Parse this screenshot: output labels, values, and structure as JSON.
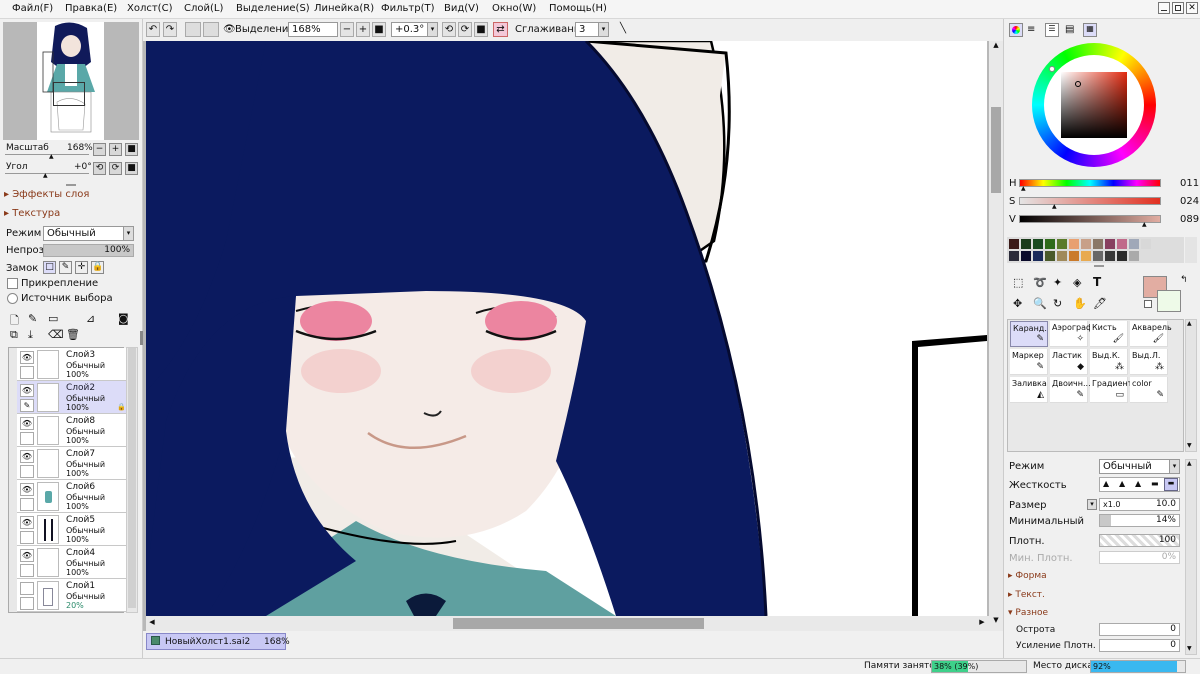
{
  "menu": [
    "Файл(F)",
    "Правка(E)",
    "Холст(C)",
    "Слой(L)",
    "Выделение(S)",
    "Линейка(R)",
    "Фильтр(T)",
    "Вид(V)",
    "Окно(W)",
    "Помощь(H)"
  ],
  "toolbar": {
    "selection_label": "Выделение",
    "zoom": "168%",
    "angle": "+0.3°",
    "smoothing_label": "Сглаживание",
    "smoothing_value": "3"
  },
  "navigator": {
    "scale_label": "Масштаб",
    "scale_value": "168%",
    "angle_label": "Угол",
    "angle_value": "+0°"
  },
  "left_panel": {
    "layer_effects": "Эффекты слоя",
    "texture": "Текстура",
    "mode_label": "Режим",
    "mode_value": "Обычный",
    "opacity_label": "Непроз.",
    "opacity_value": "100%",
    "opacity_level": 1.0,
    "lock_label": "Замок",
    "clipping_label": "Прикрепление",
    "selection_source_label": "Источник выбора"
  },
  "layers": [
    {
      "name": "Слой3",
      "mode": "Обычный",
      "opacity": "100%",
      "visible": true,
      "selected": false
    },
    {
      "name": "Слой2",
      "mode": "Обычный",
      "opacity": "100%",
      "visible": true,
      "selected": true
    },
    {
      "name": "Слой8",
      "mode": "Обычный",
      "opacity": "100%",
      "visible": true,
      "selected": false
    },
    {
      "name": "Слой7",
      "mode": "Обычный",
      "opacity": "100%",
      "visible": true,
      "selected": false
    },
    {
      "name": "Слой6",
      "mode": "Обычный",
      "opacity": "100%",
      "visible": true,
      "selected": false
    },
    {
      "name": "Слой5",
      "mode": "Обычный",
      "opacity": "100%",
      "visible": true,
      "selected": false
    },
    {
      "name": "Слой4",
      "mode": "Обычный",
      "opacity": "100%",
      "visible": true,
      "selected": false
    },
    {
      "name": "Слой1",
      "mode": "Обычный",
      "opacity": "20%",
      "visible": false,
      "selected": false
    }
  ],
  "color": {
    "h_label": "H",
    "h_value": "011",
    "s_label": "S",
    "s_value": "024",
    "v_label": "V",
    "v_value": "089",
    "current_color": "#e2ada2",
    "secondary_color": "#eefae8"
  },
  "palette": [
    "#3a1a18",
    "#1a3a1a",
    "#1a4a20",
    "#2e6a1a",
    "#5a7a2a",
    "#e8a070",
    "#c8a088",
    "#8a7868",
    "#884060",
    "#c06a8a",
    "#a0a8b8",
    "#d8d8d8",
    "#2a2a38",
    "#0a0a2a",
    "#1a2a5a",
    "#4a5a2a",
    "#a08a5a",
    "#ca7a2a",
    "#e8aa50",
    "#686868",
    "#383838",
    "#2a2a2a",
    "#aaa",
    "#ddd"
  ],
  "tools": [
    {
      "label": "Каранд.",
      "icon": "pencil-icon",
      "selected": true
    },
    {
      "label": "Аэрограф",
      "icon": "airbrush-icon",
      "selected": false
    },
    {
      "label": "Кисть",
      "icon": "brush-icon",
      "selected": false
    },
    {
      "label": "Акварель",
      "icon": "watercolor-icon",
      "selected": false
    },
    {
      "label": "Маркер",
      "icon": "marker-icon",
      "selected": false
    },
    {
      "label": "Ластик",
      "icon": "eraser-icon",
      "selected": false
    },
    {
      "label": "Выд.К.",
      "icon": "select-pen-icon",
      "selected": false
    },
    {
      "label": "Выд.Л.",
      "icon": "select-eraser-icon",
      "selected": false
    },
    {
      "label": "Заливка",
      "icon": "bucket-icon",
      "selected": false
    },
    {
      "label": "Двоичн...",
      "icon": "binary-pen-icon",
      "selected": false
    },
    {
      "label": "Градиент",
      "icon": "gradient-icon",
      "selected": false
    },
    {
      "label": "color",
      "icon": "color-pen-icon",
      "selected": false
    }
  ],
  "tool_settings": {
    "mode_label": "Режим",
    "mode_value": "Обычный",
    "hardness_label": "Жесткость",
    "size_label": "Размер",
    "size_mult": "x1.0",
    "size_value": "10.0",
    "min_label": "Минимальный",
    "min_value": "14%",
    "min_level": 0.14,
    "density_label": "Плотн.",
    "density_value": "100",
    "min_density_label": "Мин. Плотн.",
    "min_density_value": "0%",
    "shape_label": "Форма",
    "texture_label": "Текст.",
    "misc_label": "Разное",
    "sharpness_label": "Острота",
    "sharpness_value": "0",
    "density_boost_label": "Усиление Плотн.",
    "density_boost_value": "0"
  },
  "tab": {
    "name": "НовыйХолст1.sai2",
    "zoom": "168%"
  },
  "status": {
    "memory_label": "Памяти занято",
    "memory_value": "38% (39%)",
    "memory_level": 0.38,
    "disk_label": "Место диска",
    "disk_value": "92%",
    "disk_level": 0.92
  }
}
